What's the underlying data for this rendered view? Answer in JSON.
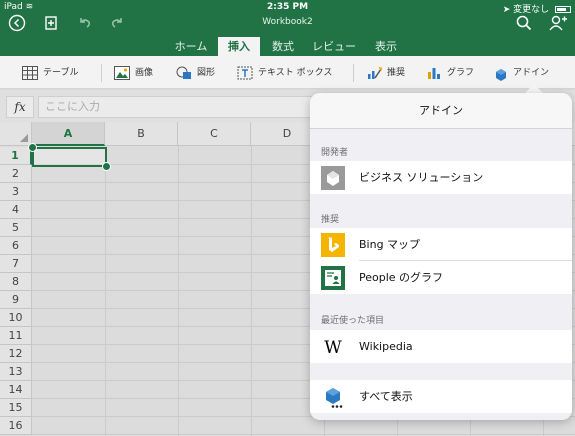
{
  "status_bar": {
    "device": "iPad",
    "time": "2:35 PM",
    "status": "変更なし"
  },
  "header": {
    "workbook_title": "Workbook2"
  },
  "tabs": [
    {
      "label": "ホーム"
    },
    {
      "label": "挿入",
      "active": true
    },
    {
      "label": "数式"
    },
    {
      "label": "レビュー"
    },
    {
      "label": "表示"
    }
  ],
  "ribbon": {
    "table": "テーブル",
    "picture": "画像",
    "shapes": "図形",
    "textbox": "テキスト ボックス",
    "recommended": "推奨",
    "chart": "グラフ",
    "addin": "アドイン"
  },
  "formula_bar": {
    "fx_label": "fx",
    "placeholder": "ここに入力"
  },
  "grid": {
    "columns": [
      "A",
      "B",
      "C",
      "D"
    ],
    "rows": [
      "1",
      "2",
      "3",
      "4",
      "5",
      "6",
      "7",
      "8",
      "9",
      "10",
      "11",
      "12",
      "13",
      "14",
      "15",
      "16"
    ],
    "selected_cell": "A1"
  },
  "addin_panel": {
    "title": "アドイン",
    "sections": {
      "developer": "開発者",
      "recommended": "推奨",
      "recent": "最近使った項目"
    },
    "items": {
      "business_solutions": "ビジネス ソリューション",
      "bing_maps": "Bing マップ",
      "people_graph": "People のグラフ",
      "wikipedia": "Wikipedia",
      "show_all": "すべて表示"
    }
  },
  "colors": {
    "brand_green": "#217346",
    "bing_yellow": "#f5b400",
    "people_green": "#217346"
  }
}
